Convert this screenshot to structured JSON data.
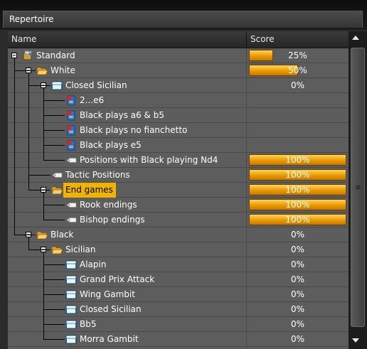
{
  "window": {
    "title": "Repertoire"
  },
  "columns": {
    "name": "Name",
    "score": "Score"
  },
  "colors": {
    "accent_bar": "#f0b400",
    "selection": "#f0b400",
    "grid_bg": "#5d5d5d",
    "header_bg": "#2f2f2f"
  },
  "rows": [
    {
      "label": "Standard",
      "score_text": "25%",
      "score": 0.25,
      "icon": "standard-database-icon",
      "expander": "collapse",
      "depth": 0
    },
    {
      "label": "White",
      "score_text": "50%",
      "score": 0.5,
      "icon": "open-folder-icon",
      "expander": "collapse",
      "depth": 1
    },
    {
      "label": "Closed Sicilian",
      "score_text": "0%",
      "score": 0,
      "icon": "blue-folder-icon",
      "expander": "collapse",
      "depth": 2
    },
    {
      "label": "2...e6",
      "score_text": "",
      "score": null,
      "icon": "game-document-icon",
      "expander": "",
      "depth": 3
    },
    {
      "label": "Black plays a6 & b5",
      "score_text": "",
      "score": null,
      "icon": "game-document-icon",
      "expander": "",
      "depth": 3
    },
    {
      "label": "Black plays no fianchetto",
      "score_text": "",
      "score": null,
      "icon": "game-document-icon",
      "expander": "",
      "depth": 3
    },
    {
      "label": "Black plays e5",
      "score_text": "",
      "score": null,
      "icon": "game-document-icon",
      "expander": "",
      "depth": 3
    },
    {
      "label": "Positions with Black playing Nd4",
      "score_text": "100%",
      "score": 1,
      "icon": "position-tag-icon",
      "expander": "",
      "depth": 3
    },
    {
      "label": "Tactic Positions",
      "score_text": "100%",
      "score": 1,
      "icon": "position-tag-icon",
      "expander": "",
      "depth": 2
    },
    {
      "label": "End games",
      "score_text": "100%",
      "score": 1,
      "icon": "open-folder-icon",
      "expander": "collapse",
      "depth": 2,
      "selected": true
    },
    {
      "label": "Rook endings",
      "score_text": "100%",
      "score": 1,
      "icon": "position-tag-icon",
      "expander": "",
      "depth": 3
    },
    {
      "label": "Bishop endings",
      "score_text": "100%",
      "score": 1,
      "icon": "position-tag-icon",
      "expander": "",
      "depth": 3
    },
    {
      "label": "Black",
      "score_text": "0%",
      "score": 0,
      "icon": "open-folder-icon",
      "expander": "collapse",
      "depth": 1
    },
    {
      "label": "Sicilian",
      "score_text": "0%",
      "score": 0,
      "icon": "open-folder-icon",
      "expander": "collapse",
      "depth": 2
    },
    {
      "label": "Alapin",
      "score_text": "0%",
      "score": 0,
      "icon": "blue-folder-icon",
      "expander": "",
      "depth": 3
    },
    {
      "label": "Grand Prix Attack",
      "score_text": "0%",
      "score": 0,
      "icon": "blue-folder-icon",
      "expander": "",
      "depth": 3
    },
    {
      "label": "Wing Gambit",
      "score_text": "0%",
      "score": 0,
      "icon": "blue-folder-icon",
      "expander": "",
      "depth": 3
    },
    {
      "label": "Closed Sicilian",
      "score_text": "0%",
      "score": 0,
      "icon": "blue-folder-icon",
      "expander": "",
      "depth": 3
    },
    {
      "label": "Bb5",
      "score_text": "0%",
      "score": 0,
      "icon": "blue-folder-icon",
      "expander": "",
      "depth": 3
    },
    {
      "label": "Morra Gambit",
      "score_text": "0%",
      "score": 0,
      "icon": "blue-folder-icon",
      "expander": "",
      "depth": 3
    }
  ]
}
